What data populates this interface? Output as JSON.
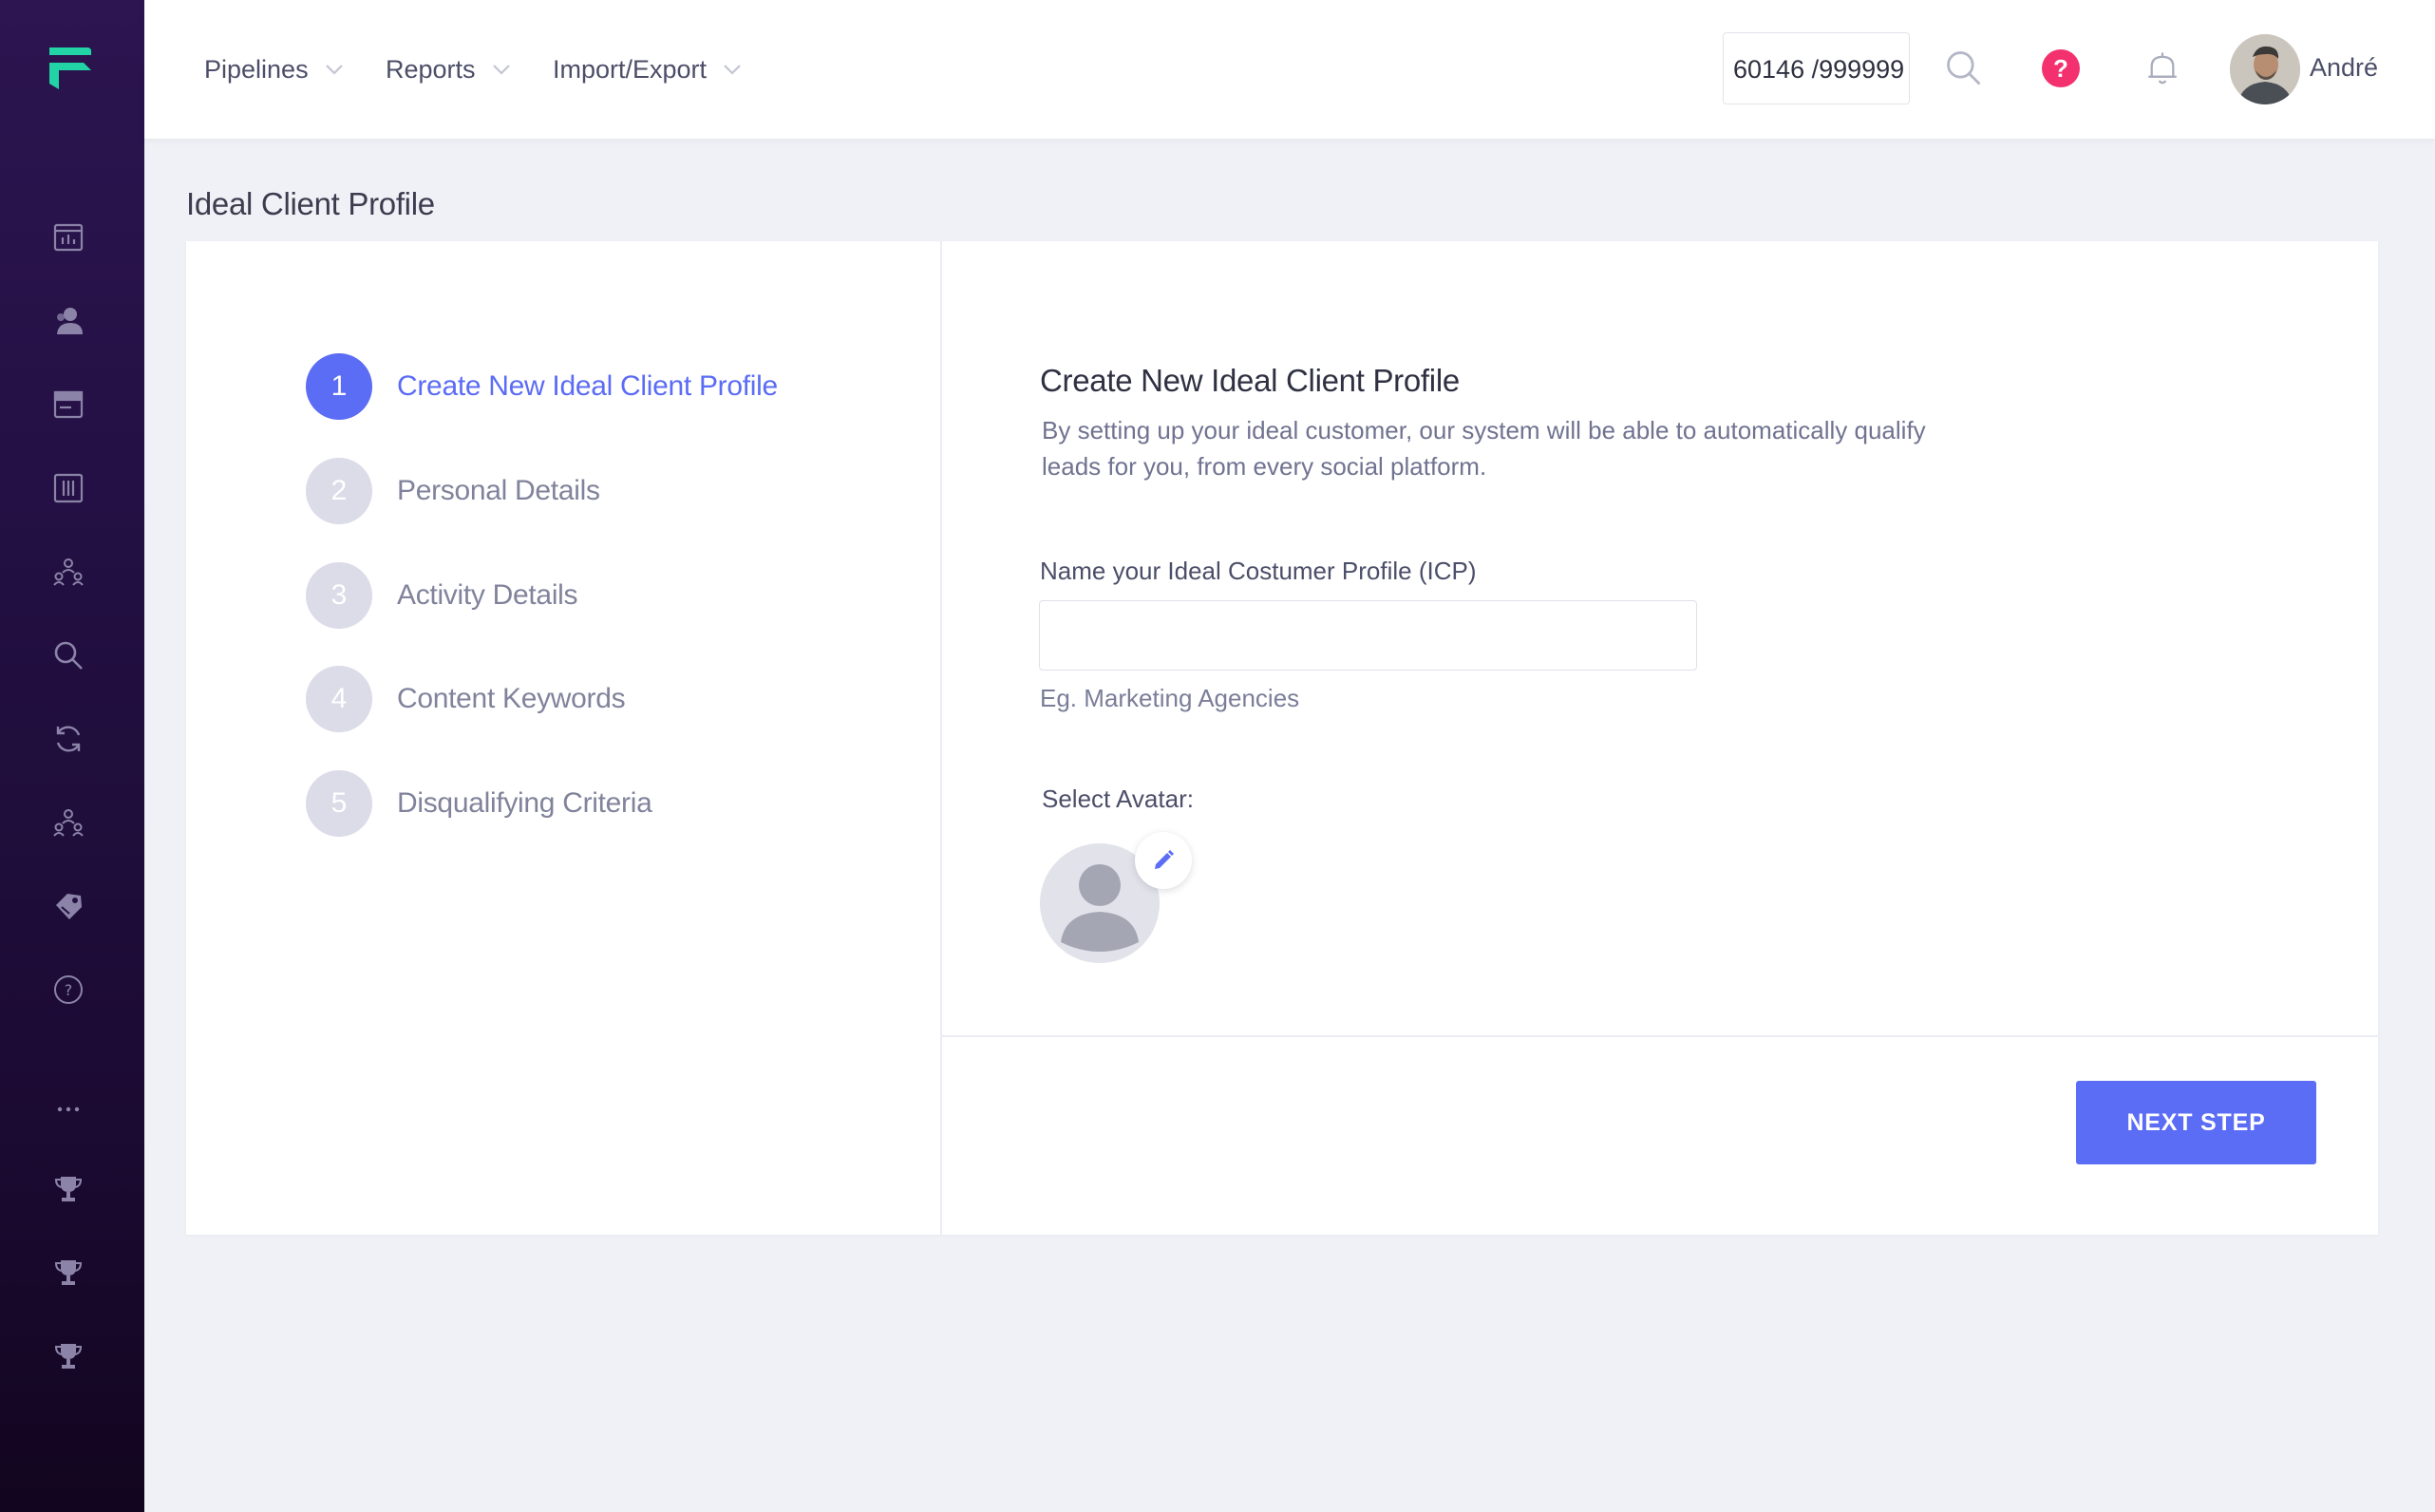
{
  "header": {
    "nav": [
      {
        "label": "Pipelines"
      },
      {
        "label": "Reports"
      },
      {
        "label": "Import/Export"
      }
    ],
    "counter_value": "60146 /999999",
    "help_label": "?",
    "user_name": "André"
  },
  "page": {
    "title": "Ideal Client Profile"
  },
  "steps": [
    {
      "number": "1",
      "label": "Create New Ideal Client Profile",
      "active": true
    },
    {
      "number": "2",
      "label": "Personal Details",
      "active": false
    },
    {
      "number": "3",
      "label": "Activity Details",
      "active": false
    },
    {
      "number": "4",
      "label": "Content Keywords",
      "active": false
    },
    {
      "number": "5",
      "label": "Disqualifying Criteria",
      "active": false
    }
  ],
  "form": {
    "title": "Create New Ideal Client Profile",
    "description": "By setting up your ideal customer, our system will be able to automatically qualify leads for you, from every social platform.",
    "icp_label": "Name your Ideal Costumer Profile (ICP)",
    "icp_value": "",
    "icp_hint": "Eg. Marketing Agencies",
    "avatar_label": "Select Avatar:",
    "next_button": "NEXT STEP"
  },
  "sidebar": {
    "icons": [
      "dashboard-icon",
      "contacts-icon",
      "browser-icon",
      "board-icon",
      "team-icon",
      "search-icon",
      "sync-icon",
      "network-icon",
      "tickets-icon",
      "help-icon",
      "more-icon",
      "trophy-icon",
      "trophy-icon",
      "trophy-icon"
    ]
  },
  "colors": {
    "accent": "#5b6cf5",
    "brand": "#20c997",
    "sidebar": "#220f41",
    "help_badge": "#f2316e"
  }
}
